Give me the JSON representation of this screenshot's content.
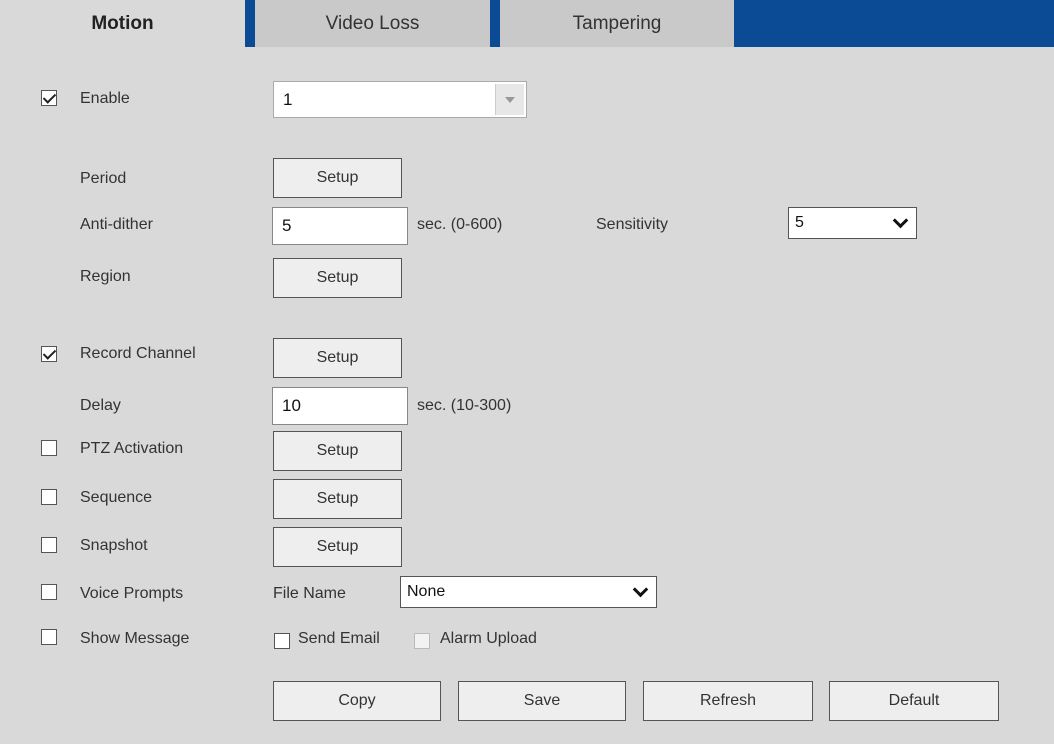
{
  "tabs": [
    {
      "label": "Motion",
      "active": true
    },
    {
      "label": "Video Loss",
      "active": false
    },
    {
      "label": "Tampering",
      "active": false
    }
  ],
  "enable": {
    "label": "Enable",
    "checked": true,
    "channel": "1"
  },
  "period": {
    "label": "Period",
    "button": "Setup"
  },
  "anti_dither": {
    "label": "Anti-dither",
    "value": "5",
    "unit": "sec. (0-600)"
  },
  "sensitivity": {
    "label": "Sensitivity",
    "value": "5"
  },
  "region": {
    "label": "Region",
    "button": "Setup"
  },
  "record_channel": {
    "label": "Record Channel",
    "checked": true,
    "button": "Setup"
  },
  "delay": {
    "label": "Delay",
    "value": "10",
    "unit": "sec. (10-300)"
  },
  "ptz_activation": {
    "label": "PTZ Activation",
    "checked": false,
    "button": "Setup"
  },
  "sequence": {
    "label": "Sequence",
    "checked": false,
    "button": "Setup"
  },
  "snapshot": {
    "label": "Snapshot",
    "checked": false,
    "button": "Setup"
  },
  "voice_prompts": {
    "label": "Voice Prompts",
    "checked": false,
    "file_label": "File Name",
    "file_value": "None"
  },
  "show_message": {
    "label": "Show Message",
    "checked": false
  },
  "send_email": {
    "label": "Send Email",
    "checked": false
  },
  "alarm_upload": {
    "label": "Alarm Upload",
    "checked": false,
    "disabled": true
  },
  "actions": {
    "copy": "Copy",
    "save": "Save",
    "refresh": "Refresh",
    "default": "Default"
  },
  "colors": {
    "tab_accent": "#0b4a94",
    "background": "#d9d9d9"
  }
}
